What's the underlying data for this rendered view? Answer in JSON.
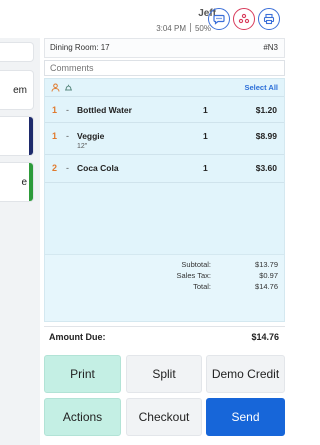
{
  "header": {
    "user_name": "Jeff",
    "time": "3:04 PM",
    "battery": "50%",
    "icons": [
      "chat-icon",
      "users-icon",
      "printer-icon"
    ]
  },
  "left_tiles": [
    {
      "label": "em",
      "bar_color": null
    },
    {
      "label": "",
      "bar_color": "#1e2a6b"
    },
    {
      "label": "e",
      "bar_color": "#2e9b3a"
    }
  ],
  "order": {
    "room": "Dining Room: 17",
    "number": "#N3",
    "comments_placeholder": "Comments",
    "select_all": "Select All",
    "items": [
      {
        "seat": "1",
        "dash": "-",
        "name": "Bottled Water",
        "modifier": "",
        "qty": "1",
        "price": "$1.20"
      },
      {
        "seat": "1",
        "dash": "-",
        "name": "Veggie",
        "modifier": "12\"",
        "qty": "1",
        "price": "$8.99"
      },
      {
        "seat": "2",
        "dash": "-",
        "name": "Coca Cola",
        "modifier": "",
        "qty": "1",
        "price": "$3.60"
      }
    ],
    "totals": {
      "subtotal_label": "Subtotal:",
      "subtotal": "$13.79",
      "tax_label": "Sales Tax:",
      "tax": "$0.97",
      "total_label": "Total:",
      "total": "$14.76"
    },
    "amount_due_label": "Amount Due:",
    "amount_due": "$14.76"
  },
  "actions": {
    "print": "Print",
    "split": "Split",
    "demo_credit": "Demo Credit",
    "actions": "Actions",
    "checkout": "Checkout",
    "send": "Send"
  },
  "colors": {
    "accent_blue": "#1766d9",
    "mint": "#c4efe4",
    "items_bg": "#e1f4fb",
    "seat_orange": "#e07a2e"
  }
}
